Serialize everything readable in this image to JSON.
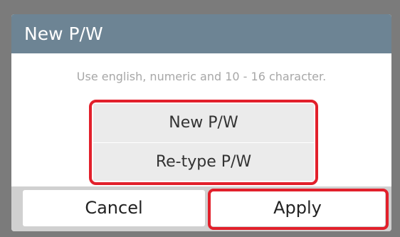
{
  "dialog": {
    "title": "New P/W",
    "hint": "Use english, numeric and 10 - 16 character.",
    "fields": {
      "new_pw": "New P/W",
      "retype_pw": "Re-type P/W"
    },
    "buttons": {
      "cancel": "Cancel",
      "apply": "Apply"
    }
  },
  "colors": {
    "titlebar": "#6d8494",
    "highlight": "#e2202b",
    "field_bg": "#ebebeb",
    "backdrop": "#7b7b7b"
  }
}
